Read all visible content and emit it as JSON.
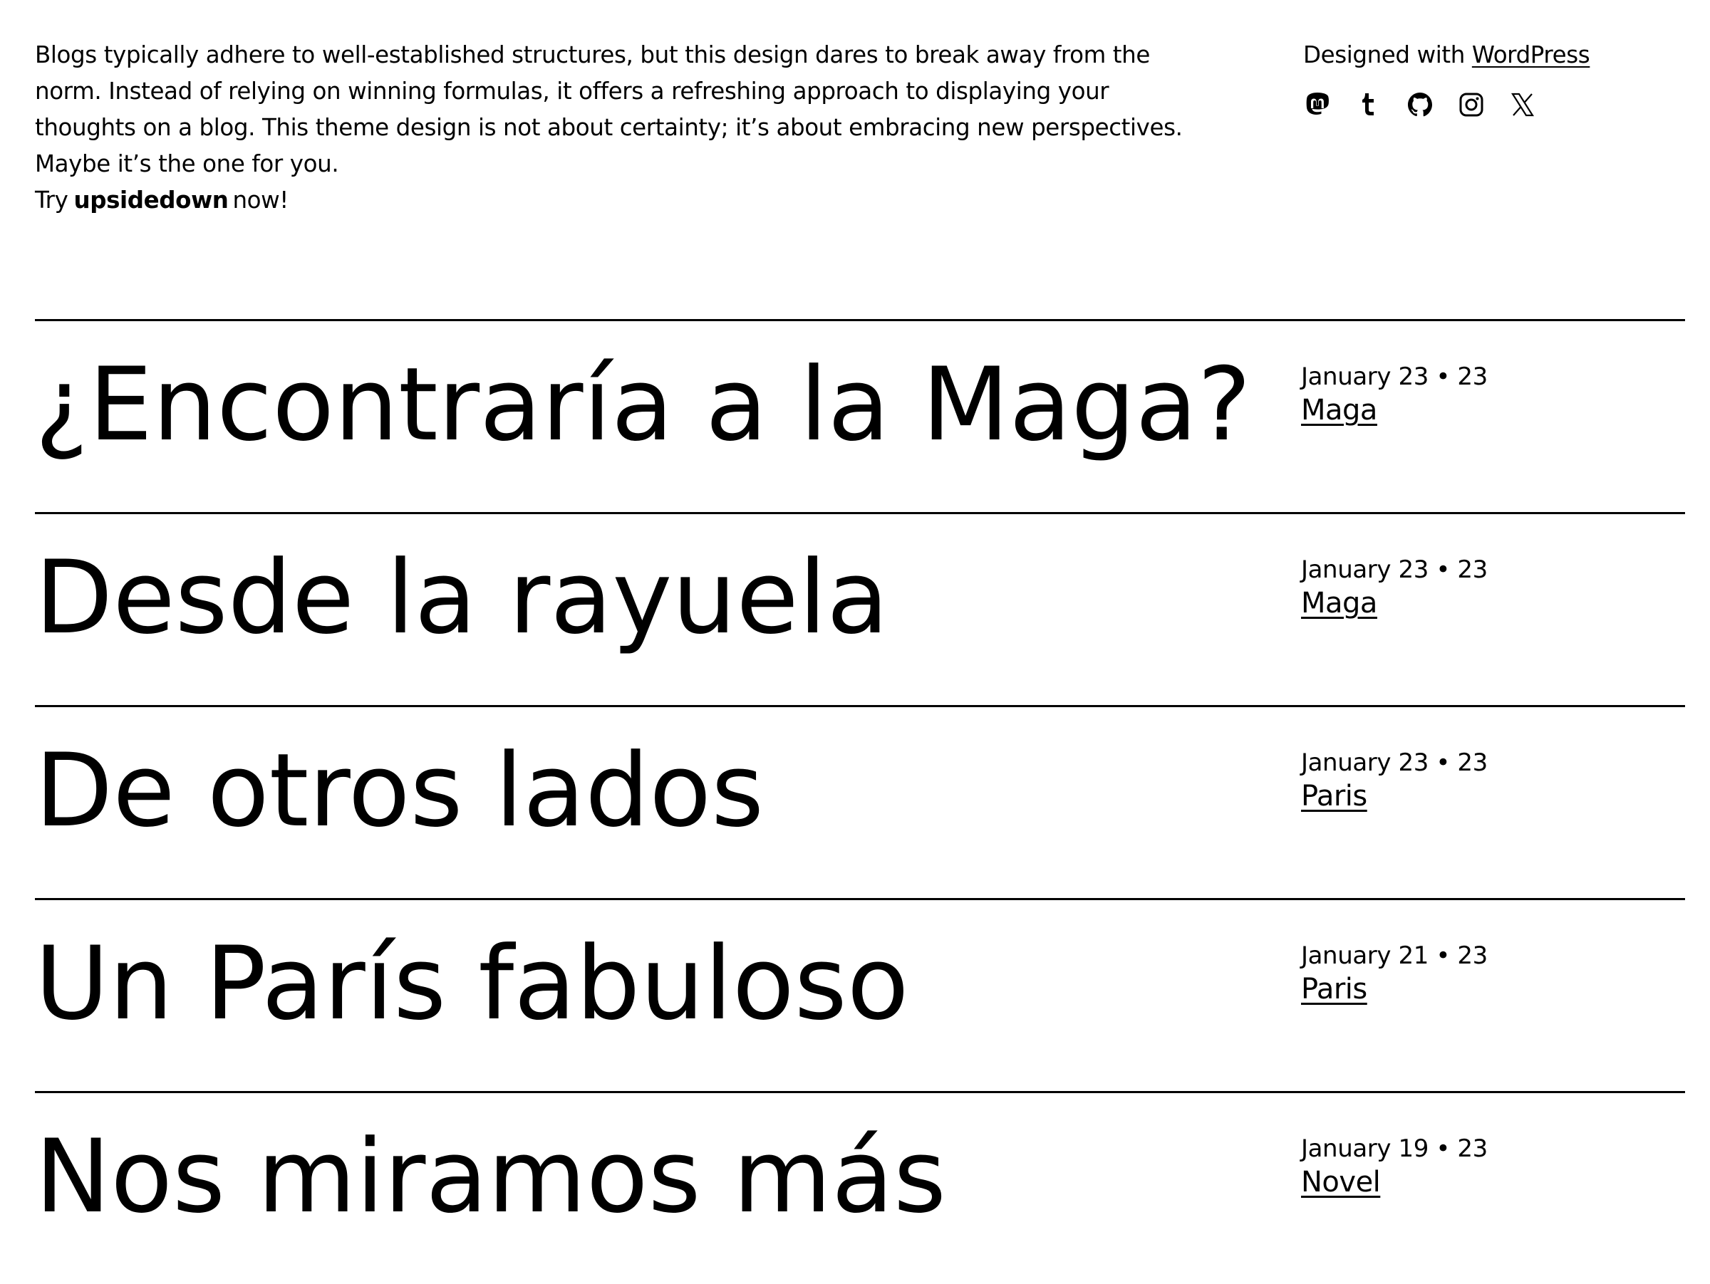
{
  "intro": {
    "text": "Blogs typically adhere to well-established structures, but this design dares to break away from the norm. Instead of relying on winning formulas, it offers a refreshing approach to displaying your thoughts on a blog. This theme design is not about certainty; it’s about embracing new perspectives. Maybe it’s the one for you.",
    "cta_prefix": "Try",
    "cta_brand": "upsidedown",
    "cta_suffix": "now!"
  },
  "credit": {
    "prefix": "Designed with ",
    "link": "WordPress"
  },
  "socials": [
    {
      "name": "mastodon-icon"
    },
    {
      "name": "tumblr-icon"
    },
    {
      "name": "github-icon"
    },
    {
      "name": "instagram-icon"
    },
    {
      "name": "x-icon"
    }
  ],
  "posts": [
    {
      "title": "¿Encontraría a la Maga?",
      "date": "January 23 • 23",
      "category": "Maga"
    },
    {
      "title": "Desde la rayuela",
      "date": "January 23 • 23",
      "category": "Maga"
    },
    {
      "title": "De otros lados",
      "date": "January 23 • 23",
      "category": "Paris"
    },
    {
      "title": "Un París fabuloso",
      "date": "January 21 • 23",
      "category": "Paris"
    },
    {
      "title": "Nos miramos más",
      "date": "January 19 • 23",
      "category": "Novel"
    }
  ],
  "colors": {
    "background": "#ffffff",
    "text": "#000000"
  }
}
